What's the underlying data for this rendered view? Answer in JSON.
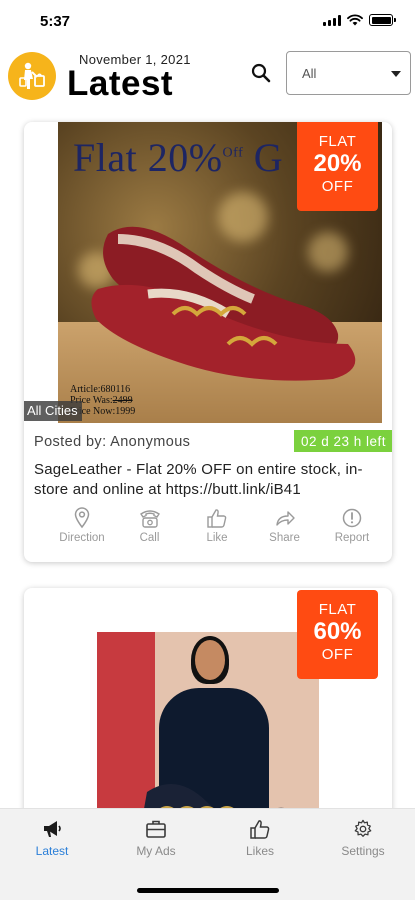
{
  "status_bar": {
    "time": "5:37"
  },
  "header": {
    "date": "November 1, 2021",
    "title": "Latest",
    "city_filter": {
      "selected": "All"
    }
  },
  "colors": {
    "brand": "#F6B41B",
    "badge": "#FF4B12",
    "time_left": "#7BD13E",
    "active_tab": "#2B7FD8"
  },
  "feed": {
    "cards": [
      {
        "image_headline": "Flat 20%",
        "image_headline_small": "Off",
        "image_headline_cut": "G",
        "image_article": "Article:680116",
        "image_price_was_label": "Price Was:",
        "image_price_was": "2499",
        "image_price_now": "Price Now:1999",
        "badge": {
          "line1": "FLAT",
          "line2": "20%",
          "line3": "OFF"
        },
        "city": "All Cities",
        "posted_by": "Posted by: Anonymous",
        "time_left": "02 d 23 h  left",
        "text": "SageLeather - Flat 20% OFF on entire stock, in-store and online at https://butt.link/iB41",
        "actions": [
          {
            "label": "Direction",
            "icon": "location-pin-icon"
          },
          {
            "label": "Call",
            "icon": "phone-icon"
          },
          {
            "label": "Like",
            "icon": "thumbs-up-icon"
          },
          {
            "label": "Share",
            "icon": "share-icon"
          },
          {
            "label": "Report",
            "icon": "report-icon"
          }
        ]
      },
      {
        "badge": {
          "line1": "FLAT",
          "line2": "60%",
          "line3": "OFF"
        }
      }
    ]
  },
  "tabbar": {
    "tabs": [
      {
        "label": "Latest",
        "icon": "megaphone-icon",
        "active": true
      },
      {
        "label": "My Ads",
        "icon": "briefcase-icon",
        "active": false
      },
      {
        "label": "Likes",
        "icon": "thumbs-up-icon",
        "active": false
      },
      {
        "label": "Settings",
        "icon": "gear-icon",
        "active": false
      }
    ]
  }
}
